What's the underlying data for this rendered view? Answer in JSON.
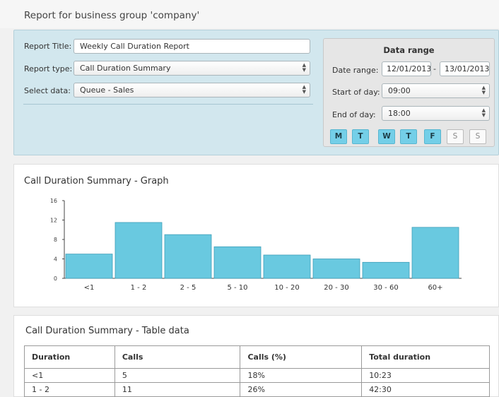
{
  "header": {
    "title": "Report for business group 'company'"
  },
  "form": {
    "title_label": "Report Title:",
    "title_value": "Weekly Call Duration Report",
    "type_label": "Report type:",
    "type_value": "Call Duration Summary",
    "data_label": "Select data:",
    "data_value": "Queue - Sales"
  },
  "range": {
    "title": "Data range",
    "date_label": "Date range:",
    "date_from": "12/01/2013",
    "date_sep": "-",
    "date_to": "13/01/2013",
    "start_label": "Start of day:",
    "start_value": "09:00",
    "end_label": "End of day:",
    "end_value": "18:00",
    "days": [
      {
        "label": "M",
        "on": true
      },
      {
        "label": "T",
        "on": true
      },
      {
        "label": "W",
        "on": true
      },
      {
        "label": "T",
        "on": true
      },
      {
        "label": "F",
        "on": true
      },
      {
        "label": "S",
        "on": false
      },
      {
        "label": "S",
        "on": false
      }
    ]
  },
  "graph": {
    "title": "Call Duration Summary - Graph"
  },
  "chart_data": {
    "type": "bar",
    "title": "Call Duration Summary - Graph",
    "categories": [
      "<1",
      "1 - 2",
      "2 - 5",
      "5 - 10",
      "10 - 20",
      "20 - 30",
      "30 - 60",
      "60+"
    ],
    "values": [
      5,
      11.5,
      9,
      6.5,
      4.8,
      4,
      3.3,
      10.5
    ],
    "yticks": [
      0,
      4,
      8,
      12,
      16
    ],
    "ylim": [
      0,
      16
    ],
    "xlabel": "",
    "ylabel": "",
    "bar_color": "#69c9e0",
    "grid": false
  },
  "table": {
    "title": "Call Duration Summary - Table data",
    "headers": [
      "Duration",
      "Calls",
      "Calls (%)",
      "Total duration"
    ],
    "rows": [
      [
        "<1",
        "5",
        "18%",
        "10:23"
      ],
      [
        "1 - 2",
        "11",
        "26%",
        "42:30"
      ]
    ]
  }
}
